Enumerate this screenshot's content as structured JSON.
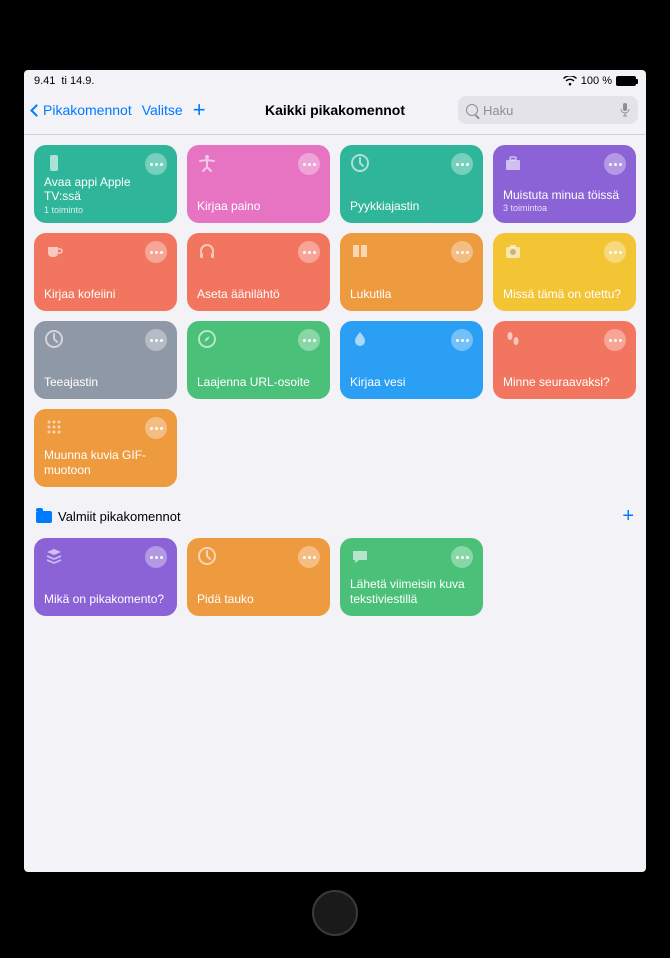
{
  "status": {
    "time": "9.41",
    "date": "ti 14.9.",
    "wifi": "wifi-icon",
    "battery_pct": "100 %"
  },
  "nav": {
    "back_label": "Pikakomennot",
    "select_label": "Valitse",
    "title": "Kaikki pikakomennot",
    "search_placeholder": "Haku"
  },
  "shortcuts_main": [
    {
      "title": "Avaa appi Apple TV:ssä",
      "sub": "1 toiminto",
      "color": "#2fb59a",
      "icon": "remote"
    },
    {
      "title": "Kirjaa paino",
      "sub": "",
      "color": "#e774c3",
      "icon": "accessibility"
    },
    {
      "title": "Pyykkiajastin",
      "sub": "",
      "color": "#2fb59a",
      "icon": "clock"
    },
    {
      "title": "Muistuta minua töissä",
      "sub": "3 toimintoa",
      "color": "#8b63d6",
      "icon": "briefcase"
    },
    {
      "title": "Kirjaa kofeiini",
      "sub": "",
      "color": "#f2765f",
      "icon": "cup"
    },
    {
      "title": "Aseta äänilähtö",
      "sub": "",
      "color": "#f2765f",
      "icon": "headphones"
    },
    {
      "title": "Lukutila",
      "sub": "",
      "color": "#ee9a3f",
      "icon": "book"
    },
    {
      "title": "Missä tämä on otettu?",
      "sub": "",
      "color": "#f3c433",
      "icon": "camera"
    },
    {
      "title": "Teeajastin",
      "sub": "",
      "color": "#8f98a6",
      "icon": "clock"
    },
    {
      "title": "Laajenna URL-osoite",
      "sub": "",
      "color": "#4bc079",
      "icon": "safari"
    },
    {
      "title": "Kirjaa vesi",
      "sub": "",
      "color": "#2a9ff4",
      "icon": "drop"
    },
    {
      "title": "Minne seuraavaksi?",
      "sub": "",
      "color": "#f2765f",
      "icon": "footsteps"
    },
    {
      "title": "Muunna kuvia GIF-muotoon",
      "sub": "",
      "color": "#ee9a3f",
      "icon": "grid"
    }
  ],
  "section2": {
    "title": "Valmiit pikakomennot"
  },
  "shortcuts_ready": [
    {
      "title": "Mikä on pikakomento?",
      "sub": "",
      "color": "#8b63d6",
      "icon": "stack"
    },
    {
      "title": "Pidä tauko",
      "sub": "",
      "color": "#ee9a3f",
      "icon": "clock"
    },
    {
      "title": "Lähetä viimeisin kuva tekstiviestillä",
      "sub": "",
      "color": "#4bc079",
      "icon": "chat"
    }
  ]
}
